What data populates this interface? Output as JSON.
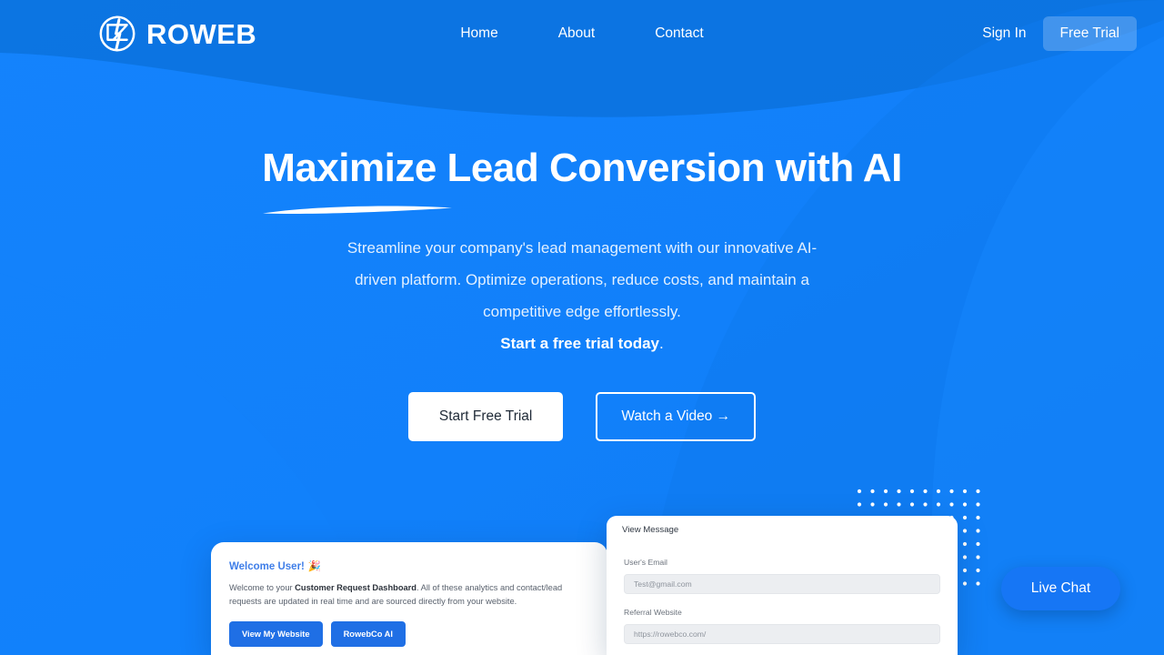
{
  "theme": {
    "bg_primary": "#1180FA",
    "bg_dark_wave": "#0B72DC",
    "accent": "#1676F5",
    "white": "#FFFFFF"
  },
  "header": {
    "brand": {
      "logo_icon": "roweb-circle-z-logo",
      "name": "ROWEB"
    },
    "nav": [
      {
        "label": "Home"
      },
      {
        "label": "About"
      },
      {
        "label": "Contact"
      }
    ],
    "actions": {
      "signin_label": "Sign In",
      "free_trial_label": "Free Trial"
    }
  },
  "hero": {
    "title": "Maximize Lead Conversion with AI",
    "underline_decoration": "brush-underline",
    "subtitle": "Streamline your company's lead management with our innovative AI-driven platform. Optimize operations, reduce costs, and maintain a competitive edge effortlessly.",
    "subtitle_strong": "Start a free trial today",
    "subtitle_strong_suffix": ".",
    "cta_primary": "Start Free Trial",
    "cta_secondary": "Watch a Video →"
  },
  "mockups": {
    "dashboard_card": {
      "greeting": "Welcome User!",
      "greeting_emoji": "🎉",
      "body_prefix": "Welcome to your ",
      "body_strong": "Customer Request Dashboard",
      "body_suffix": ". All of these analytics and contact/lead requests are updated in real time and are sourced directly from your website.",
      "buttons": [
        {
          "label": "View My Website"
        },
        {
          "label": "RowebCo AI"
        }
      ]
    },
    "message_card": {
      "title": "View Message",
      "fields": [
        {
          "label": "User's Email",
          "value": "Test@gmail.com"
        },
        {
          "label": "Referral Website",
          "value": "https://rowebco.com/"
        }
      ]
    }
  },
  "widgets": {
    "live_chat_label": "Live Chat",
    "dot_grid": {
      "columns": 10,
      "rows": 8,
      "spacing": 14.5,
      "radius": 2.1
    }
  }
}
